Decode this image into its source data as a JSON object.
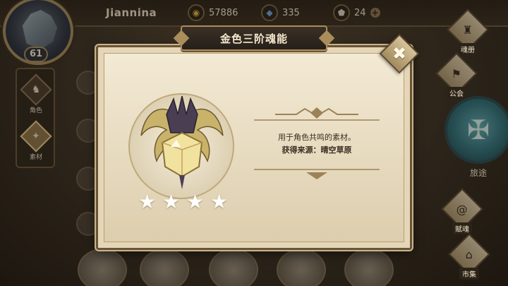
{
  "player": {
    "name": "Jiannina",
    "level": "61"
  },
  "resources": {
    "gold": "57886",
    "crystal": "335",
    "ore": "24",
    "plus": "+"
  },
  "left_menu": {
    "items": [
      {
        "label": "角色",
        "icon": "helmet-icon",
        "active": false
      },
      {
        "label": "素材",
        "icon": "bag-icon",
        "active": true
      }
    ]
  },
  "right_menu": {
    "items": [
      {
        "label": "魂册",
        "icon": "book-icon"
      },
      {
        "label": "公会",
        "icon": "shield-icon"
      },
      {
        "label": "旅途",
        "icon": "compass-icon"
      },
      {
        "label": "赋魂",
        "icon": "spiral-icon"
      },
      {
        "label": "市集",
        "icon": "tent-icon"
      }
    ]
  },
  "modal": {
    "title": "金色三阶魂能",
    "close_glyph": "✖",
    "description": "用于角色共鸣的素材。",
    "source": "获得来源：晴空草原",
    "stars": 4,
    "star_glyph": "★",
    "item_icon": "gold-soul-energy-icon"
  },
  "colors": {
    "gold_accent": "#a98d5a",
    "parchment": "#e7dabd",
    "title_plate": "#2e261d",
    "teal_orb": "#3f8a93"
  }
}
